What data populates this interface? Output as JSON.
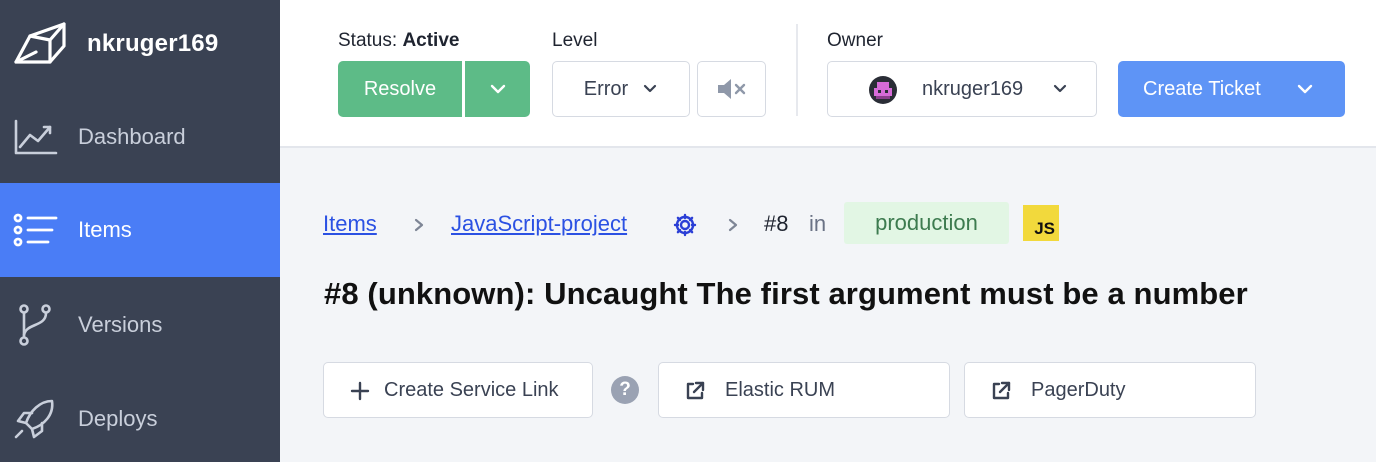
{
  "sidebar": {
    "username": "nkruger169",
    "items": [
      {
        "label": "Dashboard",
        "icon": "chart-line-icon",
        "active": false
      },
      {
        "label": "Items",
        "icon": "list-icon",
        "active": true
      },
      {
        "label": "Versions",
        "icon": "branch-icon",
        "active": false
      },
      {
        "label": "Deploys",
        "icon": "rocket-icon",
        "active": false
      }
    ]
  },
  "toolbar": {
    "status_prefix": "Status:",
    "status_value": "Active",
    "resolve_label": "Resolve",
    "level_label": "Level",
    "level_value": "Error",
    "owner_label": "Owner",
    "owner_value": "nkruger169",
    "create_ticket_label": "Create Ticket"
  },
  "breadcrumb": {
    "items_link": "Items",
    "project_link": "JavaScript-project",
    "item_number": "#8",
    "in_text": "in",
    "environment": "production",
    "language_badge": "JS"
  },
  "item": {
    "title": "#8 (unknown): Uncaught The first argument must be a number"
  },
  "links": {
    "create_service_link": "Create Service Link",
    "help": "?",
    "elastic_rum": "Elastic RUM",
    "pagerduty": "PagerDuty"
  },
  "colors": {
    "sidebar_bg": "#3a4253",
    "active_nav": "#4a7df6",
    "resolve_green": "#5dbb87",
    "ticket_blue": "#5e94f6",
    "link_blue": "#2b51e3",
    "env_badge_bg": "#e2f6e4",
    "js_badge": "#f2d93c"
  }
}
